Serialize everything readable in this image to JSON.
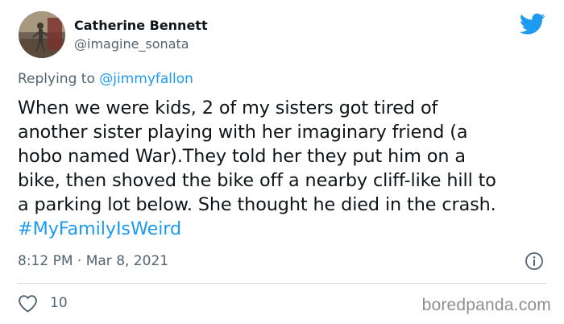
{
  "author": {
    "display_name": "Catherine Bennett",
    "handle": "@imagine_sonata"
  },
  "reply": {
    "prefix": "Replying to ",
    "mention": "@jimmyfallon"
  },
  "tweet": {
    "lines": [
      "When we were kids, 2 of my sisters got tired of",
      "another sister playing with her imaginary friend (a",
      "hobo named War).They told her they put him on a",
      "bike, then shoved the bike off a nearby cliff-like hill to",
      "a parking lot below. She thought he died in the crash."
    ],
    "hashtag": "#MyFamilyIsWeird"
  },
  "meta": {
    "timestamp": "8:12 PM · Mar 8, 2021"
  },
  "stats": {
    "likes": "10"
  },
  "watermark": "boredpanda.com",
  "colors": {
    "twitter_blue": "#1d9bf0",
    "muted_text": "#536471",
    "main_text": "#0f1419",
    "watermark": "#8f8f8f"
  },
  "icons": [
    "avatar-photo",
    "twitter-bird-icon",
    "info-icon",
    "heart-icon"
  ]
}
